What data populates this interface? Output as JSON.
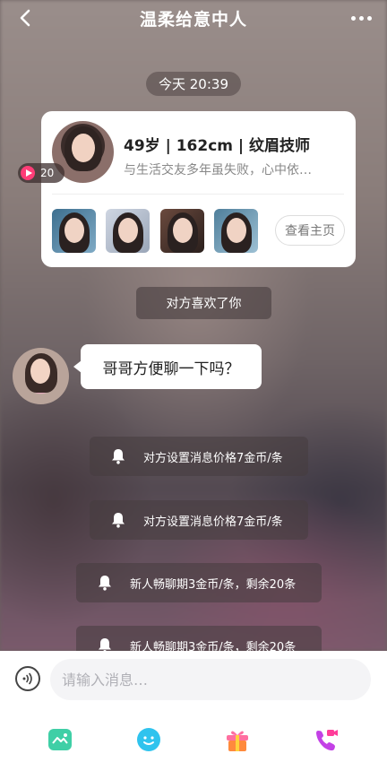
{
  "header": {
    "title": "温柔给意中人",
    "back_icon": "back-arrow-icon",
    "more_icon": "more-dots-icon"
  },
  "chat": {
    "time_divider": "今天 20:39",
    "profile_card": {
      "video_count": "20",
      "info": "49岁 | 162cm | 纹眉技师",
      "bio": "与生活交友多年虽失败，心中依…",
      "homepage_button": "查看主页"
    },
    "system_liked": "对方喜欢了你",
    "message": "哥哥方便聊一下吗？",
    "notices": [
      "对方设置消息价格7金币/条",
      "对方设置消息价格7金币/条",
      "新人畅聊期3金币/条，剩余20条",
      "新人畅聊期3金币/条，剩余20条"
    ]
  },
  "composer": {
    "placeholder": "请输入消息…",
    "voice_icon": "voice-icon",
    "tools": [
      {
        "name": "image-icon",
        "color": "#3fcfa6"
      },
      {
        "name": "emoji-icon",
        "color": "#2fc3ee"
      },
      {
        "name": "gift-icon",
        "color": "#ff6fa0"
      },
      {
        "name": "video-call-icon",
        "color": "#c341e6"
      }
    ]
  },
  "colors": {
    "accent_pink": "#ff3d77",
    "bubble_white": "#ffffff"
  }
}
